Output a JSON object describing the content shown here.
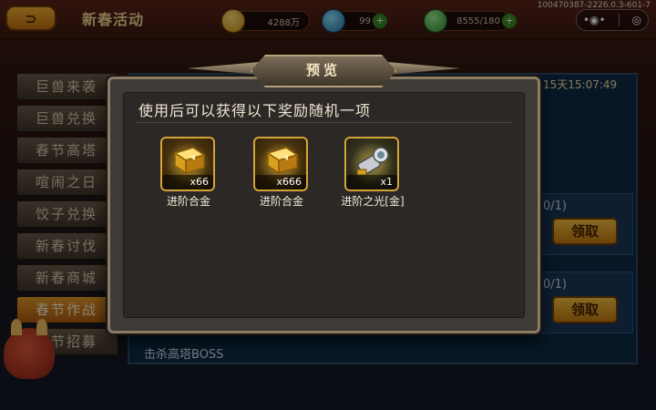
{
  "header": {
    "back_label": "⊃",
    "title": "新春活动",
    "gold": "4288万",
    "gems": "99",
    "stamina": "8555/180",
    "user_id": "100470387-2226.0.3-601-7",
    "menu_icon": "•◉•",
    "close_icon": "◎"
  },
  "sidebar": {
    "items": [
      {
        "label": "巨兽来袭"
      },
      {
        "label": "巨兽兑换"
      },
      {
        "label": "春节高塔"
      },
      {
        "label": "喧闹之日"
      },
      {
        "label": "饺子兑换"
      },
      {
        "label": "新春讨伐"
      },
      {
        "label": "新春商城"
      },
      {
        "label": "春节作战",
        "active": true
      },
      {
        "label": "春节招募"
      }
    ]
  },
  "content": {
    "timer": "15天15:07:49",
    "tasks": [
      {
        "count": "(0/1)",
        "claim_label": "领取"
      },
      {
        "count": "(0/1)",
        "claim_label": "领取"
      }
    ],
    "bottom_task": "击杀高塔BOSS"
  },
  "dialog": {
    "title": "预览",
    "description": "使用后可以获得以下奖励随机一项",
    "rewards": [
      {
        "name": "进阶合金",
        "quantity": "x66",
        "icon": "gold-alloy-icon"
      },
      {
        "name": "进阶合金",
        "quantity": "x666",
        "icon": "gold-alloy-icon"
      },
      {
        "name": "进阶之光[金]",
        "quantity": "x1",
        "icon": "light-cannon-icon"
      }
    ]
  },
  "colors": {
    "accent_gold": "#d4a33a",
    "dialog_bg": "#3f3a36",
    "active_tab": "#e29a2a",
    "claim_button": "#f4c040"
  }
}
